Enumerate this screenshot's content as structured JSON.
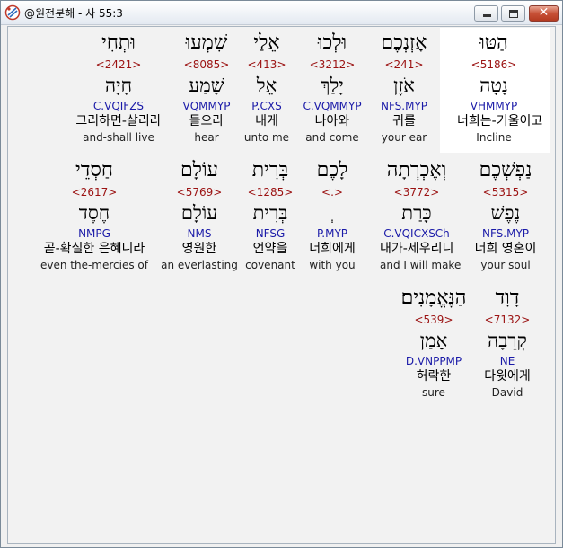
{
  "window": {
    "title": "@원전분해 - 사 55:3"
  },
  "verse_lines": [
    [
      {
        "hebrew": "הַטּוּ",
        "strong": "<5186>",
        "lemma": "נָטָה",
        "morph": "VHMMYP",
        "korean": "너희는-기울이고",
        "english": "Incline"
      },
      {
        "hebrew": "אָזְנְכֶם",
        "strong": "<241>",
        "lemma": "אֹזֶן",
        "morph": "NFS.MYP",
        "korean": "귀를",
        "english": "your ear"
      },
      {
        "hebrew": "וּלְכוּ",
        "strong": "<3212>",
        "lemma": "יָלַךְ",
        "morph": "C.VQMMYP",
        "korean": "나아와",
        "english": "and come"
      },
      {
        "hebrew": "אֵלַי",
        "strong": "<413>",
        "lemma": "אֵל",
        "morph": "P.CXS",
        "korean": "내게",
        "english": "unto me"
      },
      {
        "hebrew": "שִׁמְעוּ",
        "strong": "<8085>",
        "lemma": "שָׁמַע",
        "morph": "VQMMYP",
        "korean": "들으라",
        "english": "hear"
      },
      {
        "hebrew": "וּתְחִי",
        "strong": "<2421>",
        "lemma": "חָיָה",
        "morph": "C.VQIFZS",
        "korean": "그리하면-살리라",
        "english": "and-shall live"
      }
    ],
    [
      {
        "hebrew": "נַפְשְׁכֶם",
        "strong": "<5315>",
        "lemma": "נֶפֶשׁ",
        "morph": "NFS.MYP",
        "korean": "너희 영혼이",
        "english": "your soul"
      },
      {
        "hebrew": "וְאֶכְרְתָה",
        "strong": "<3772>",
        "lemma": "כָּרַת",
        "morph": "C.VQICXSCh",
        "korean": "내가-세우리니",
        "english": "and I will make"
      },
      {
        "hebrew": "לָכֶם",
        "strong": "<.>",
        "lemma": "ְ",
        "morph": "P.MYP",
        "korean": "너희에게",
        "english": "with you"
      },
      {
        "hebrew": "בְּרִית",
        "strong": "<1285>",
        "lemma": "בְּרִית",
        "morph": "NFSG",
        "korean": "언약을",
        "english": "covenant"
      },
      {
        "hebrew": "עוֹלָם",
        "strong": "<5769>",
        "lemma": "עוֹלָם",
        "morph": "NMS",
        "korean": "영원한",
        "english": "an everlasting"
      },
      {
        "hebrew": "חַסְדֵי",
        "strong": "<2617>",
        "lemma": "חֶסֶד",
        "morph": "NMPG",
        "korean": "곧-확실한 은혜니라",
        "english": "even the-mercies of"
      }
    ],
    [
      {
        "hebrew": "דָוִד",
        "strong": "<7132>",
        "lemma": "קְרֵבָה",
        "morph": "NE",
        "korean": "다윗에게",
        "english": "David"
      },
      {
        "hebrew": "הַנֶּאֱמָנִים׃",
        "strong": "<539>",
        "lemma": "אָמַן",
        "morph": "D.VNPPMP",
        "korean": "허락한",
        "english": "sure"
      }
    ]
  ]
}
